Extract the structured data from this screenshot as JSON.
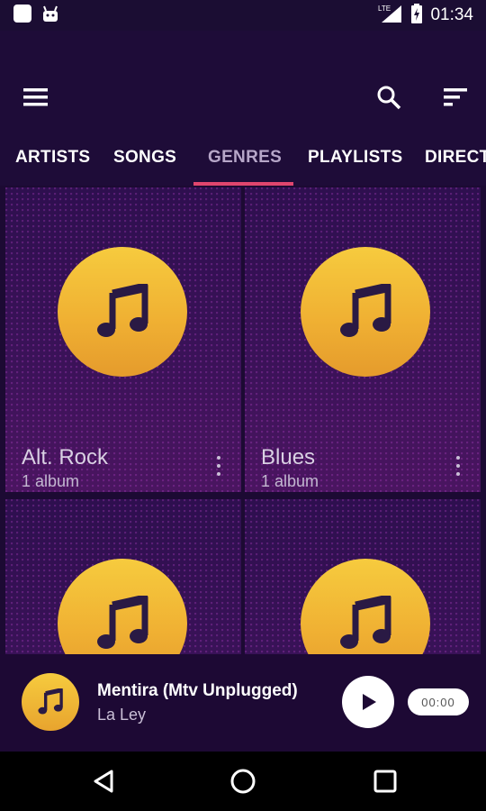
{
  "status_bar": {
    "time": "01:34",
    "network": "LTE",
    "icons": [
      "app-icon",
      "android-icon",
      "signal-icon",
      "battery-icon"
    ]
  },
  "toolbar": {
    "icons": [
      "menu-icon",
      "search-icon",
      "sort-icon"
    ]
  },
  "tabs": [
    {
      "label": "ARTISTS",
      "active": false
    },
    {
      "label": "SONGS",
      "active": false
    },
    {
      "label": "GENRES",
      "active": true
    },
    {
      "label": "PLAYLISTS",
      "active": false
    },
    {
      "label": "DIRECT",
      "active": false
    }
  ],
  "genres": [
    {
      "name": "Alt. Rock",
      "count": "1 album"
    },
    {
      "name": "Blues",
      "count": "1 album"
    },
    {
      "name": "",
      "count": ""
    },
    {
      "name": "",
      "count": ""
    }
  ],
  "player": {
    "title": "Mentira (Mtv Unplugged)",
    "artist": "La Ley",
    "time": "00:00"
  },
  "colors": {
    "background": "#1a0b2e",
    "accent": "#e0466e",
    "disc": "#f2b936",
    "active_tab": "#b6a6c8"
  }
}
